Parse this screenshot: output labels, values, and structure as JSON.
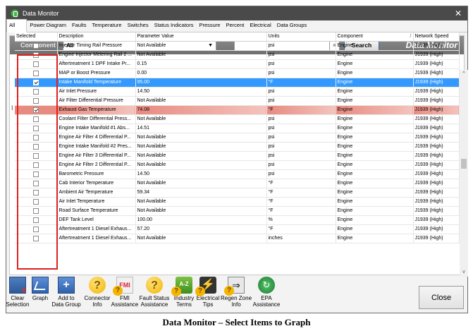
{
  "window": {
    "title": "Data Monitor",
    "close_glyph": "✕",
    "icon": "data-monitor-app-icon"
  },
  "tabs": [
    "All",
    "Power Diagram",
    "Faults",
    "Temperature",
    "Switches",
    "Status Indicators",
    "Pressure",
    "Percent",
    "Electrical",
    "Data Groups"
  ],
  "active_tab": "All",
  "filter": {
    "component_label": "Component",
    "component_value": "All",
    "search_value": "",
    "clear_glyph": "×",
    "search_button": "Search",
    "brand": "Data Monitor"
  },
  "columns": [
    "Selected",
    "Description",
    "Parameter Value",
    "Units",
    "Component",
    "Network Speed"
  ],
  "sort_indicator": "/",
  "rows": [
    {
      "selected": false,
      "description": "Injector Timing Rail Pressure",
      "value": "Not Available",
      "units": "psi",
      "component": "Engine",
      "speed": "J1939 (High)",
      "state": ""
    },
    {
      "selected": false,
      "description": "Engine Injector Metering Rail 2 ...",
      "value": "Not Available",
      "units": "psi",
      "component": "Engine",
      "speed": "J1939 (High)",
      "state": ""
    },
    {
      "selected": false,
      "description": "Aftertreatment 1 DPF Intake Pr...",
      "value": "0.15",
      "units": "psi",
      "component": "Engine",
      "speed": "J1939 (High)",
      "state": ""
    },
    {
      "selected": false,
      "description": "MAP or Boost Pressure",
      "value": "0.00",
      "units": "psi",
      "component": "Engine",
      "speed": "J1939 (High)",
      "state": ""
    },
    {
      "selected": true,
      "description": "Intake Manifold Temperature",
      "value": "95.00",
      "units": "°F",
      "component": "Engine",
      "speed": "J1939 (High)",
      "state": "focused"
    },
    {
      "selected": false,
      "description": "Air Inlet Pressure",
      "value": "14.50",
      "units": "psi",
      "component": "Engine",
      "speed": "J1939 (High)",
      "state": ""
    },
    {
      "selected": false,
      "description": "Air Filter Differential Pressure",
      "value": "Not Available",
      "units": "psi",
      "component": "Engine",
      "speed": "J1939 (High)",
      "state": ""
    },
    {
      "selected": true,
      "description": "Exhaust Gas Temperature",
      "value": "74.08",
      "units": "°F",
      "component": "Engine",
      "speed": "J1939 (High)",
      "state": "highlighted"
    },
    {
      "selected": false,
      "description": "Coolant Filter Differential Press...",
      "value": "Not Available",
      "units": "psi",
      "component": "Engine",
      "speed": "J1939 (High)",
      "state": ""
    },
    {
      "selected": false,
      "description": "Engine Intake Manifold #1 Abs...",
      "value": "14.51",
      "units": "psi",
      "component": "Engine",
      "speed": "J1939 (High)",
      "state": ""
    },
    {
      "selected": false,
      "description": "Engine Air Filter 4 Differential P...",
      "value": "Not Available",
      "units": "psi",
      "component": "Engine",
      "speed": "J1939 (High)",
      "state": ""
    },
    {
      "selected": false,
      "description": "Engine Intake Manifold #2 Pres...",
      "value": "Not Available",
      "units": "psi",
      "component": "Engine",
      "speed": "J1939 (High)",
      "state": ""
    },
    {
      "selected": false,
      "description": "Engine Air Filter 3 Differential P...",
      "value": "Not Available",
      "units": "psi",
      "component": "Engine",
      "speed": "J1939 (High)",
      "state": ""
    },
    {
      "selected": false,
      "description": "Engine Air Filter 2 Differential P...",
      "value": "Not Available",
      "units": "psi",
      "component": "Engine",
      "speed": "J1939 (High)",
      "state": ""
    },
    {
      "selected": false,
      "description": "Barometric Pressure",
      "value": "14.50",
      "units": "psi",
      "component": "Engine",
      "speed": "J1939 (High)",
      "state": ""
    },
    {
      "selected": false,
      "description": "Cab Interior Temperature",
      "value": "Not Available",
      "units": "°F",
      "component": "Engine",
      "speed": "J1939 (High)",
      "state": ""
    },
    {
      "selected": false,
      "description": "Ambient Air Temperature",
      "value": "59.34",
      "units": "°F",
      "component": "Engine",
      "speed": "J1939 (High)",
      "state": ""
    },
    {
      "selected": false,
      "description": "Air Inlet Temperature",
      "value": "Not Available",
      "units": "°F",
      "component": "Engine",
      "speed": "J1939 (High)",
      "state": ""
    },
    {
      "selected": false,
      "description": "Road Surface Temperature",
      "value": "Not Available",
      "units": "°F",
      "component": "Engine",
      "speed": "J1939 (High)",
      "state": ""
    },
    {
      "selected": false,
      "description": "DEF Tank Level",
      "value": "100.00",
      "units": "%",
      "component": "Engine",
      "speed": "J1939 (High)",
      "state": ""
    },
    {
      "selected": false,
      "description": "Aftertreatment 1 Diesel Exhaus...",
      "value": "57.20",
      "units": "°F",
      "component": "Engine",
      "speed": "J1939 (High)",
      "state": ""
    },
    {
      "selected": false,
      "description": "Aftertreatment 1 Diesel Exhaus...",
      "value": "Not Available",
      "units": "inches",
      "component": "Engine",
      "speed": "J1939 (High)",
      "state": ""
    }
  ],
  "row_marker": "I",
  "scroll": {
    "up": "^",
    "down": "v"
  },
  "toolbar": [
    {
      "name": "clear-selection",
      "icon": "clear-selection-icon",
      "label": "Clear\nSelection"
    },
    {
      "name": "graph",
      "icon": "graph-icon",
      "label": "Graph"
    },
    {
      "name": "add-to-data-group",
      "icon": "add-icon",
      "label": "Add to\nData Group"
    },
    {
      "name": "connector-info",
      "icon": "connector-info-icon",
      "label": "Connector\nInfo"
    },
    {
      "name": "fmi-assistance",
      "icon": "fmi-icon",
      "label": "FMI\nAssistance"
    },
    {
      "name": "fault-status-assistance",
      "icon": "fault-status-icon",
      "label": "Fault Status\nAssistance"
    },
    {
      "name": "industry-terms",
      "icon": "industry-terms-icon",
      "label": "Industry\nTerms"
    },
    {
      "name": "electrical-tips",
      "icon": "electrical-tips-icon",
      "label": "Electrical\nTips"
    },
    {
      "name": "regen-zone-info",
      "icon": "regen-zone-icon",
      "label": "Regen Zone\nInfo"
    },
    {
      "name": "epa-assistance",
      "icon": "epa-icon",
      "label": "EPA\nAssistance"
    }
  ],
  "close_button": "Close",
  "caption": "Data Monitor – Select Items to Graph",
  "colors": {
    "titlebar": "#4a4a4a",
    "focus_row": "#3399ff",
    "highlight_row": "#e88a80",
    "selected_box": "#e01f1f"
  }
}
